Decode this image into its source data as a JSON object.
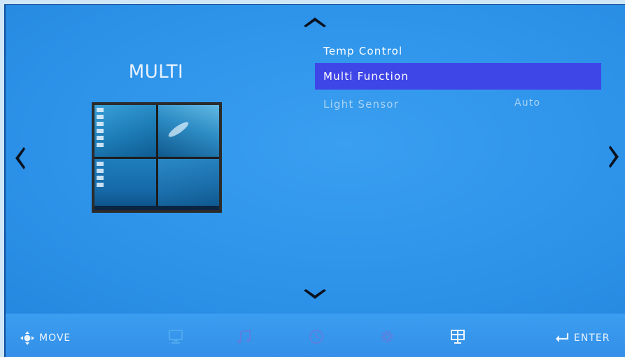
{
  "panel": {
    "title": "MULTI"
  },
  "menu": {
    "items": [
      {
        "label": "Temp Control"
      },
      {
        "label": "Multi Function"
      },
      {
        "label": "Light Sensor",
        "value": "Auto"
      }
    ],
    "selected_index": 1
  },
  "navigation": {
    "up_icon": "chevron-up-icon",
    "down_icon": "chevron-down-icon",
    "left_icon": "chevron-left-icon",
    "right_icon": "chevron-right-icon"
  },
  "bottom_bar": {
    "move_label": "MOVE",
    "enter_label": "ENTER",
    "categories": [
      "monitor-icon",
      "music-icon",
      "clock-icon",
      "gear-icon",
      "layout-icon"
    ]
  },
  "colors": {
    "background": "#2e94ea",
    "selected": "#3f46e8",
    "text": "#ffffff",
    "dim_text": "#a8d2f5"
  }
}
